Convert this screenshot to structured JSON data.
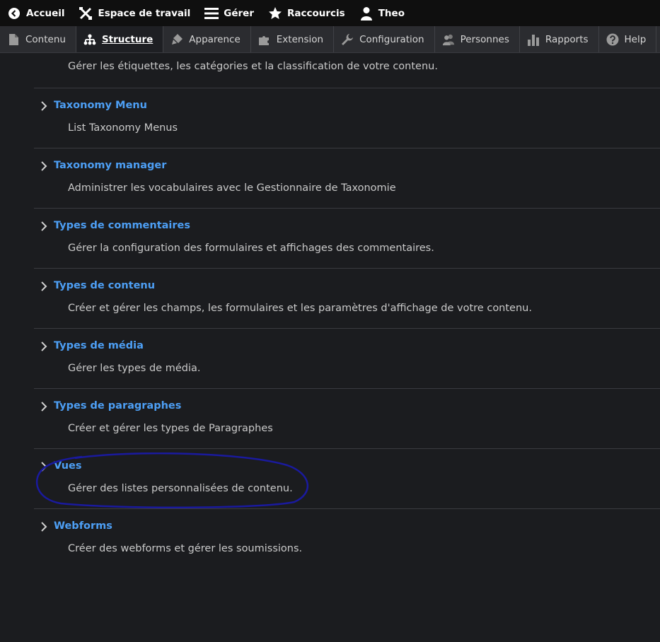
{
  "toolbar": {
    "home": "Accueil",
    "workspace": "Espace de travail",
    "manage": "Gérer",
    "shortcuts": "Raccourcis",
    "user": "Theo"
  },
  "tray": {
    "items": [
      {
        "label": "Contenu",
        "icon": "file-icon"
      },
      {
        "label": "Structure",
        "icon": "sitemap-icon",
        "active": true
      },
      {
        "label": "Apparence",
        "icon": "paintbrush-icon"
      },
      {
        "label": "Extension",
        "icon": "puzzle-icon"
      },
      {
        "label": "Configuration",
        "icon": "wrench-icon"
      },
      {
        "label": "Personnes",
        "icon": "people-icon"
      },
      {
        "label": "Rapports",
        "icon": "bar-chart-icon"
      },
      {
        "label": "Help",
        "icon": "help-icon"
      }
    ]
  },
  "list": {
    "top_desc": "Gérer les étiquettes, les catégories et la classification de votre contenu.",
    "entries": [
      {
        "title": "Taxonomy Menu",
        "desc": "List Taxonomy Menus"
      },
      {
        "title": "Taxonomy manager",
        "desc": "Administrer les vocabulaires avec le Gestionnaire de Taxonomie"
      },
      {
        "title": "Types de commentaires",
        "desc": "Gérer la configuration des formulaires et affichages des commentaires."
      },
      {
        "title": "Types de contenu",
        "desc": "Créer et gérer les champs, les formulaires et les paramètres d'affichage de votre contenu."
      },
      {
        "title": "Types de média",
        "desc": "Gérer les types de média."
      },
      {
        "title": "Types de paragraphes",
        "desc": "Créer et gérer les types de Paragraphes"
      },
      {
        "title": "Vues",
        "desc": "Gérer des listes personnalisées de contenu."
      },
      {
        "title": "Webforms",
        "desc": "Créer des webforms et gérer les soumissions."
      }
    ]
  },
  "colors": {
    "link": "#4d9ff5",
    "annotation": "#1a1a9e"
  }
}
